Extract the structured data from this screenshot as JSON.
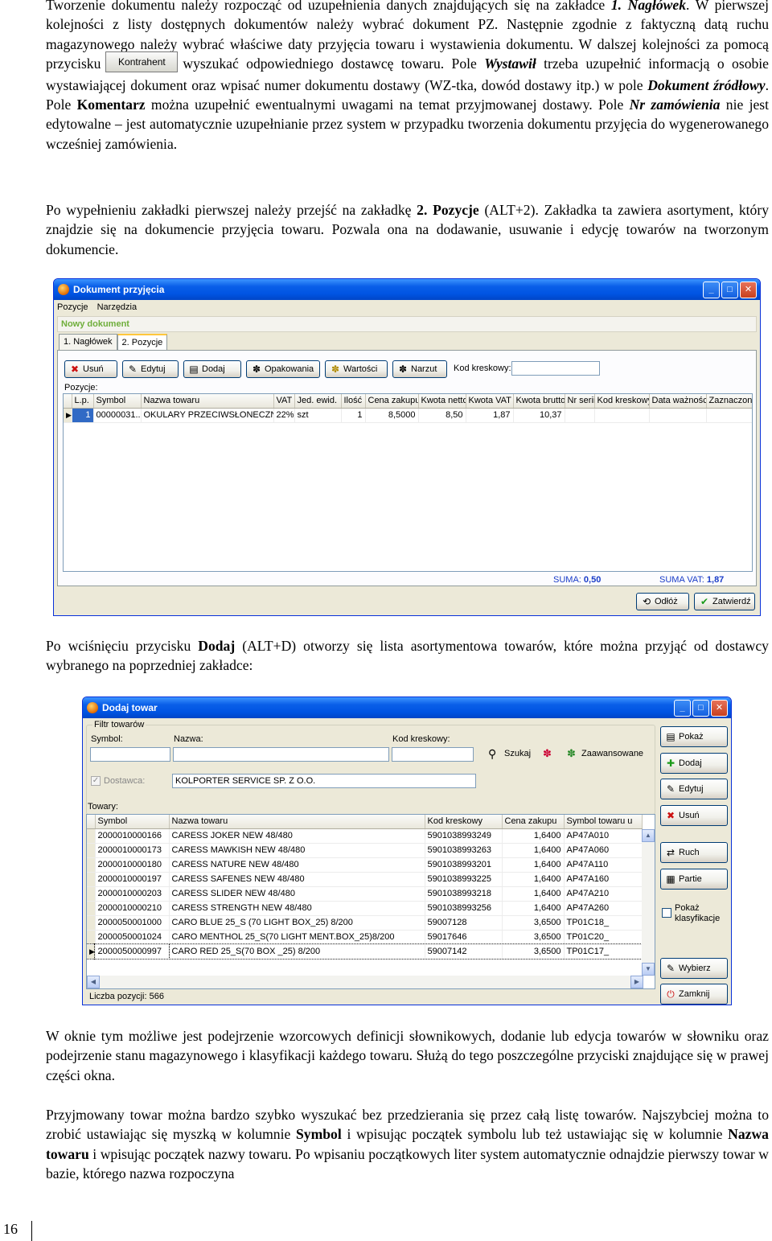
{
  "page_number": "16",
  "p1": {
    "t1": "Tworzenie dokumentu należy rozpocząć od uzupełnienia danych znajdujących się na zakładce ",
    "t2": "1. Nagłówek",
    "t3": ". W pierwszej kolejności z listy dostępnych dokumentów należy wybrać dokument PZ. Następnie zgodnie z faktyczną datą ruchu magazynowego należy wybrać właściwe daty przyjęcia towaru i wystawienia dokumentu. W dalszej kolejności za pomocą przycisku",
    "btn": "Kontrahent",
    "t4": "wyszukać odpowiedniego dostawcę towaru. Pole ",
    "t5": "Wystawił",
    "t6": " trzeba uzupełnić informacją o osobie wystawiającej dokument oraz wpisać numer dokumentu dostawy (WZ-tka, dowód dostawy itp.) w pole ",
    "t7": "Dokument źródłowy",
    "t8": ". Pole ",
    "t9": "Komentarz",
    "t10": " można uzupełnić ewentualnymi uwagami na temat przyjmowanej dostawy. Pole ",
    "t11": "Nr zamówienia",
    "t12": " nie jest edytowalne – jest automatycznie uzupełnianie przez system w przypadku tworzenia dokumentu przyjęcia do wygenerowanego wcześniej zamówienia."
  },
  "p2": {
    "t1": "Po wypełnieniu zakładki pierwszej należy przejść na zakładkę ",
    "t2": "2. Pozycje",
    "t3": " (ALT+2). Zakładka ta zawiera asortyment, który znajdzie się na dokumencie przyjęcia towaru. Pozwala ona na dodawanie, usuwanie i edycję towarów na tworzonym dokumencie."
  },
  "win1": {
    "title": "Dokument przyjęcia",
    "menu": [
      "Pozycje",
      "Narzędzia"
    ],
    "status": "Nowy dokument",
    "tabs": [
      "1. Nagłówek",
      "2. Pozycje"
    ],
    "toolbar": [
      "Usuń",
      "Edytuj",
      "Dodaj",
      "Opakowania",
      "Wartości",
      "Narzut"
    ],
    "barcode_label": "Kod kreskowy:",
    "positions_label": "Pozycje:",
    "columns": [
      "L.p.",
      "Symbol",
      "Nazwa towaru",
      "VAT",
      "Jed. ewid.",
      "Ilość",
      "Cena zakupu",
      "Kwota netto",
      "Kwota VAT",
      "Kwota brutto",
      "Nr serii",
      "Kod kreskowy",
      "Data ważności",
      "Zaznaczone"
    ],
    "rows": [
      [
        "1",
        "00000031...",
        "OKULARY PRZECIWSŁONECZNE",
        "22%",
        "szt",
        "1",
        "8,5000",
        "8,50",
        "1,87",
        "10,37",
        "",
        "",
        "",
        ""
      ]
    ],
    "sum_label": "SUMA:",
    "sum_value": "0,50",
    "sum_vat_label": "SUMA VAT:",
    "sum_vat_value": "1,87",
    "refresh": "Odłóż",
    "confirm": "Zatwierdź"
  },
  "p3": {
    "t1": "Po wciśnięciu przycisku ",
    "t2": "Dodaj",
    "t3": " (ALT+D) otworzy się lista asortymentowa towarów, które można przyjąć od dostawcy wybranego na poprzedniej zakładce:"
  },
  "win2": {
    "title": "Dodaj towar",
    "filter_label": "Filtr towarów",
    "symbol_label": "Symbol:",
    "name_label": "Nazwa:",
    "barcode_label": "Kod kreskowy:",
    "search": "Szukaj",
    "advanced": "Zaawansowane",
    "supplier_label": "Dostawca:",
    "supplier_value": "KOLPORTER SERVICE SP. Z O.O.",
    "goods_label": "Towary:",
    "columns": [
      "Symbol",
      "Nazwa towaru",
      "Kod kreskowy",
      "Cena zakupu",
      "Symbol towaru u"
    ],
    "rows": [
      [
        "2000010000166",
        "CARESS JOKER NEW 48/480",
        "5901038993249",
        "1,6400",
        "AP47A010"
      ],
      [
        "2000010000173",
        "CARESS MAWKISH NEW 48/480",
        "5901038993263",
        "1,6400",
        "AP47A060"
      ],
      [
        "2000010000180",
        "CARESS NATURE NEW 48/480",
        "5901038993201",
        "1,6400",
        "AP47A110"
      ],
      [
        "2000010000197",
        "CARESS SAFENES NEW 48/480",
        "5901038993225",
        "1,6400",
        "AP47A160"
      ],
      [
        "2000010000203",
        "CARESS SLIDER NEW 48/480",
        "5901038993218",
        "1,6400",
        "AP47A210"
      ],
      [
        "2000010000210",
        "CARESS STRENGTH NEW 48/480",
        "5901038993256",
        "1,6400",
        "AP47A260"
      ],
      [
        "2000050001000",
        "CARO BLUE 25_S (70 LIGHT BOX_25) 8/200",
        "59007128",
        "3,6500",
        "TP01C18_"
      ],
      [
        "2000050001024",
        "CARO MENTHOL 25_S(70 LIGHT MENT.BOX_25)8/200",
        "59017646",
        "3,6500",
        "TP01C20_"
      ],
      [
        "2000050000997",
        "CARO RED 25_S(70 BOX _25) 8/200",
        "59007142",
        "3,6500",
        "TP01C17_"
      ]
    ],
    "count": "Liczba pozycji: 566",
    "side_buttons": [
      "Pokaż",
      "Dodaj",
      "Edytuj",
      "Usuń",
      "Ruch",
      "Partie"
    ],
    "show_class": "Pokaż klasyfikacje",
    "choose": "Wybierz",
    "close": "Zamknij"
  },
  "p4": {
    "t1": "W oknie tym możliwe jest podejrzenie wzorcowych definicji słownikowych, dodanie lub edycja towarów w słowniku oraz podejrzenie stanu magazynowego i klasyfikacji każdego towaru. Służą do tego poszczególne przyciski znajdujące się w prawej części okna."
  },
  "p5": {
    "t1": "Przyjmowany towar można bardzo szybko wyszukać bez przedzierania się przez całą listę towarów. Najszybciej można to zrobić ustawiając się myszką w kolumnie ",
    "t2": "Symbol",
    "t3": " i wpisując początek symbolu lub też ustawiając się w kolumnie ",
    "t4": "Nazwa towaru",
    "t5": " i wpisując początek nazwy towaru. Po wpisaniu początkowych liter system automatycznie odnajdzie pierwszy towar w bazie, którego nazwa rozpoczyna"
  }
}
